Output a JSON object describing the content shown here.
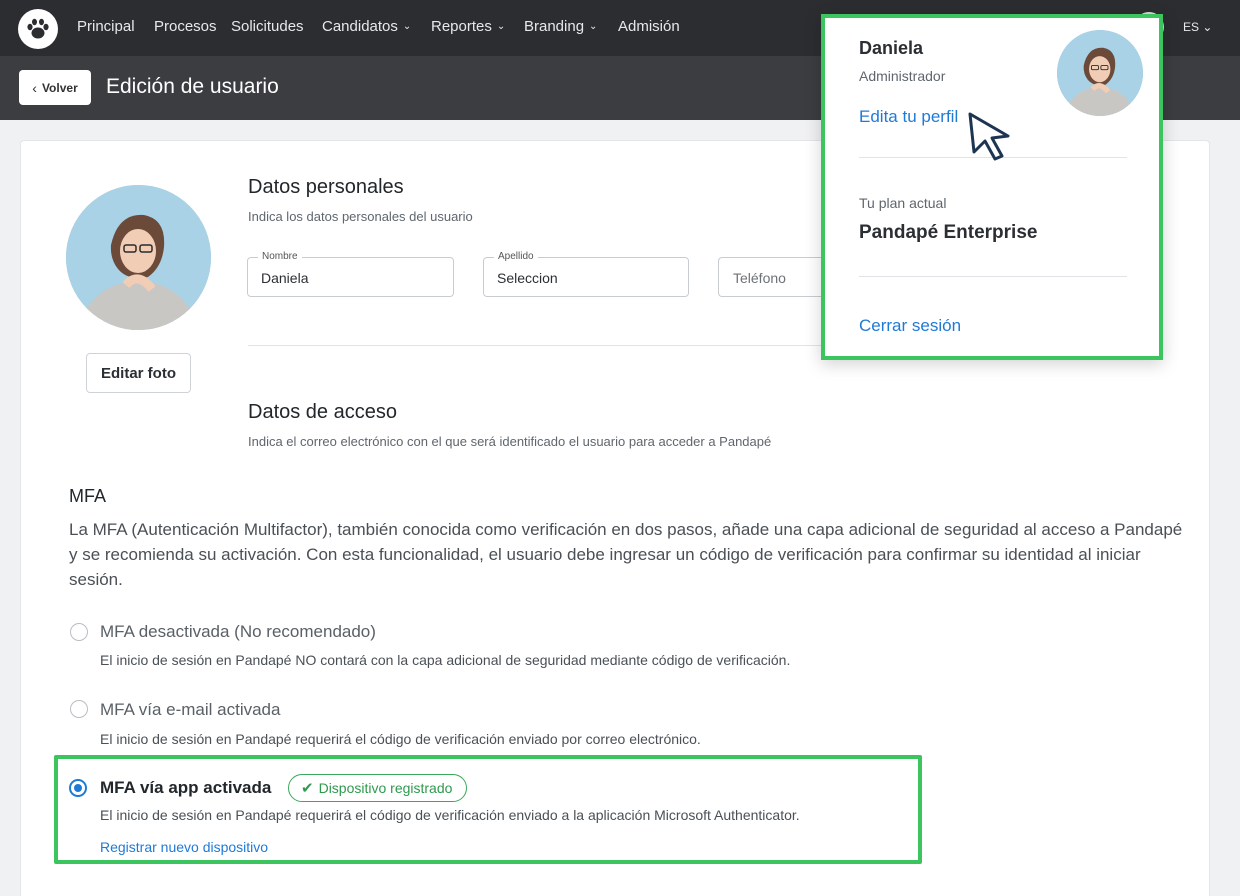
{
  "nav": {
    "items": [
      {
        "label": "Principal",
        "dropdown": false
      },
      {
        "label": "Procesos",
        "dropdown": false
      },
      {
        "label": "Solicitudes",
        "dropdown": false
      },
      {
        "label": "Candidatos",
        "dropdown": true
      },
      {
        "label": "Reportes",
        "dropdown": true
      },
      {
        "label": "Branding",
        "dropdown": true
      },
      {
        "label": "Admisión",
        "dropdown": false
      }
    ],
    "language": "ES"
  },
  "header": {
    "back_label": "Volver",
    "title": "Edición de usuario"
  },
  "profile": {
    "edit_photo_label": "Editar foto"
  },
  "personal": {
    "title": "Datos personales",
    "subtitle": "Indica los datos personales del usuario",
    "nombre_label": "Nombre",
    "nombre_value": "Daniela",
    "apellido_label": "Apellido",
    "apellido_value": "Seleccion",
    "telefono_placeholder": "Teléfono"
  },
  "access": {
    "title": "Datos de acceso",
    "subtitle": "Indica el correo electrónico con el que será identificado el usuario para acceder a Pandapé"
  },
  "mfa": {
    "title": "MFA",
    "description": "La MFA (Autenticación Multifactor), también conocida como verificación en dos pasos, añade una capa adicional de seguridad al acceso a Pandapé y se recomienda su activación. Con esta funcionalidad, el usuario debe ingresar un código de verificación para confirmar su identidad al iniciar sesión.",
    "options": [
      {
        "label": "MFA desactivada (No recomendado)",
        "description": "El inicio de sesión en Pandapé NO contará con la capa adicional de seguridad mediante código de verificación.",
        "selected": false
      },
      {
        "label": "MFA vía e-mail activada",
        "description": "El inicio de sesión en Pandapé requerirá el código de verificación enviado por correo electrónico.",
        "selected": false
      },
      {
        "label": "MFA vía app activada",
        "description": "El inicio de sesión en Pandapé requerirá el código de verificación enviado a la aplicación Microsoft Authenticator.",
        "selected": true
      }
    ],
    "badge": "Dispositivo registrado",
    "register_link": "Registrar nuevo dispositivo"
  },
  "dropdown": {
    "name": "Daniela",
    "role": "Administrador",
    "edit_profile": "Edita tu perfil",
    "plan_label": "Tu plan actual",
    "plan": "Pandapé Enterprise",
    "logout": "Cerrar sesión"
  },
  "colors": {
    "accent": "#1f7ad6",
    "highlight": "#3cc45f",
    "nav_bg": "#2b2d30",
    "success": "#2f9a4e"
  }
}
